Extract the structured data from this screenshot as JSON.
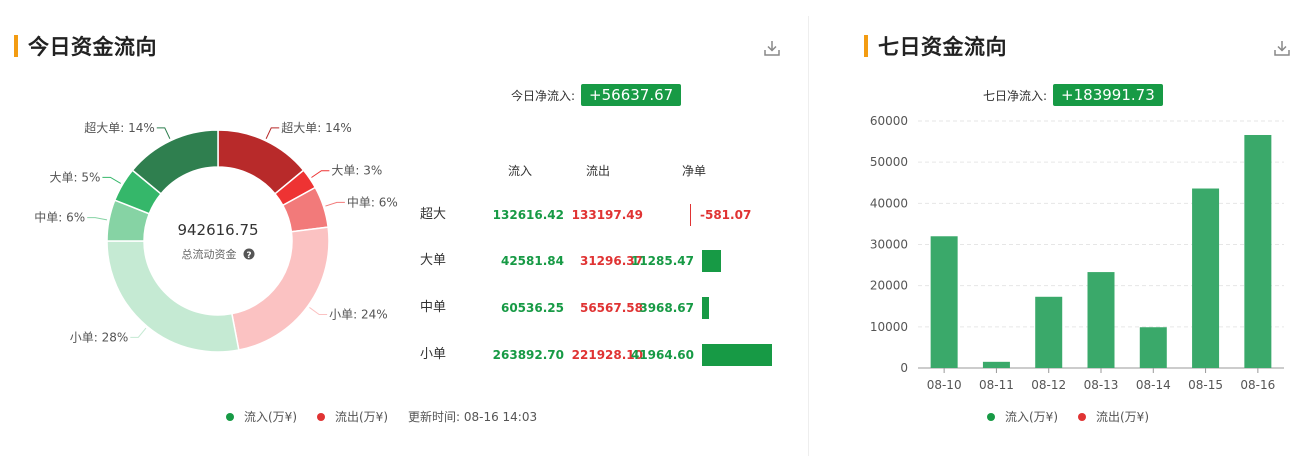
{
  "left": {
    "title": "今日资金流向",
    "net_label": "今日净流入:",
    "net_value": "+56637.67",
    "center_value": "942616.75",
    "center_label": "总流动资金",
    "legend": {
      "inflow": "流入(万¥)",
      "outflow": "流出(万¥)",
      "update": "更新时间: 08-16 14:03"
    },
    "table": {
      "headers": {
        "in": "流入",
        "out": "流出",
        "net": "净单"
      },
      "rows": [
        {
          "label": "超大",
          "in": "132616.42",
          "out": "133197.49",
          "net": "-581.07",
          "net_num": -581.07
        },
        {
          "label": "大单",
          "in": "42581.84",
          "out": "31296.37",
          "net": "11285.47",
          "net_num": 11285.47
        },
        {
          "label": "中单",
          "in": "60536.25",
          "out": "56567.58",
          "net": "3968.67",
          "net_num": 3968.67
        },
        {
          "label": "小单",
          "in": "263892.70",
          "out": "221928.10",
          "net": "41964.60",
          "net_num": 41964.6
        }
      ]
    }
  },
  "right": {
    "title": "七日资金流向",
    "net_label": "七日净流入:",
    "net_value": "+183991.73",
    "legend": {
      "inflow": "流入(万¥)",
      "outflow": "流出(万¥)"
    }
  },
  "colors": {
    "green": "#179a45",
    "red": "#e03333",
    "accent": "#f39c12",
    "bar_green": "#3aa96a"
  },
  "chart_data": [
    {
      "type": "pie",
      "variant": "donut",
      "slices": [
        {
          "label": "超大单: 14%",
          "name": "超大单",
          "percent": 14,
          "flow": "out",
          "color": "#b82a2a"
        },
        {
          "label": "大单: 3%",
          "name": "大单",
          "percent": 3,
          "flow": "out",
          "color": "#ee3333"
        },
        {
          "label": "中单: 6%",
          "name": "中单",
          "percent": 6,
          "flow": "out",
          "color": "#f27a7a"
        },
        {
          "label": "小单: 24%",
          "name": "小单",
          "percent": 24,
          "flow": "out",
          "color": "#fbc2c2"
        },
        {
          "label": "小单: 28%",
          "name": "小单",
          "percent": 28,
          "flow": "in",
          "color": "#c5ead3"
        },
        {
          "label": "中单: 6%",
          "name": "中单",
          "percent": 6,
          "flow": "in",
          "color": "#86d3a4"
        },
        {
          "label": "大单: 5%",
          "name": "大单",
          "percent": 5,
          "flow": "in",
          "color": "#35b76a"
        },
        {
          "label": "超大单: 14%",
          "name": "超大单",
          "percent": 14,
          "flow": "in",
          "color": "#2f7f4f"
        }
      ]
    },
    {
      "type": "bar",
      "categories": [
        "08-10",
        "08-11",
        "08-12",
        "08-13",
        "08-14",
        "08-15",
        "08-16"
      ],
      "values": [
        32000,
        1500,
        17300,
        23300,
        9900,
        43600,
        56600
      ],
      "ylim": [
        0,
        60000
      ],
      "yticks": [
        "0",
        "10000",
        "20000",
        "30000",
        "40000",
        "50000",
        "60000"
      ],
      "grid": true
    }
  ]
}
